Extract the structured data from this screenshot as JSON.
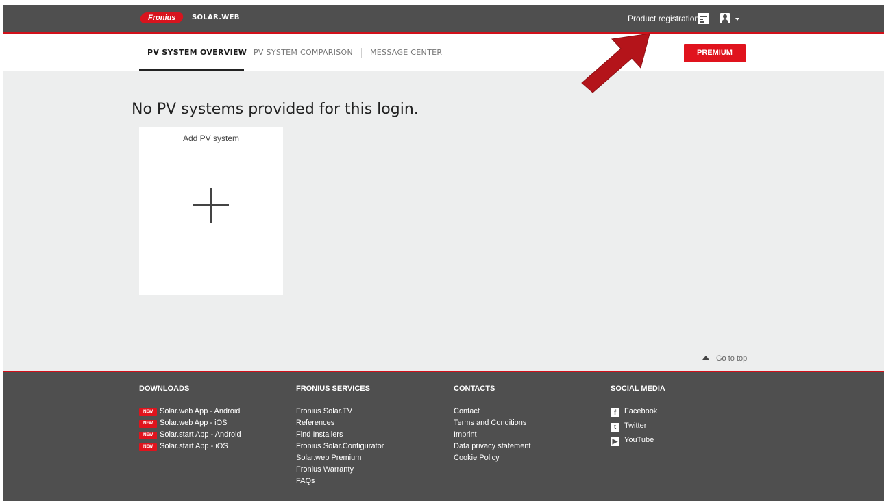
{
  "header": {
    "logo_text": "Fronius",
    "brand": "SOLAR.WEB",
    "product_registration": "Product registration"
  },
  "nav": {
    "tabs": [
      {
        "label": "PV SYSTEM OVERVIEW",
        "active": true
      },
      {
        "label": "PV SYSTEM COMPARISON",
        "active": false
      },
      {
        "label": "MESSAGE CENTER",
        "active": false
      }
    ],
    "premium_label": "PREMIUM"
  },
  "main": {
    "headline": "No PV systems provided for this login.",
    "add_card_label": "Add PV system",
    "go_to_top": "Go to top"
  },
  "footer": {
    "downloads": {
      "title": "DOWNLOADS",
      "new_tag": "NEW",
      "items": [
        "Solar.web App - Android",
        "Solar.web App - iOS",
        "Solar.start App - Android",
        "Solar.start App - iOS"
      ]
    },
    "services": {
      "title": "FRONIUS SERVICES",
      "items": [
        "Fronius Solar.TV",
        "References",
        "Find Installers",
        "Fronius Solar.Configurator",
        "Solar.web Premium",
        "Fronius Warranty",
        "FAQs"
      ]
    },
    "contacts": {
      "title": "CONTACTS",
      "items": [
        "Contact",
        "Terms and Conditions",
        "Imprint",
        "Data privacy statement",
        "Cookie Policy"
      ]
    },
    "social": {
      "title": "SOCIAL MEDIA",
      "items": [
        {
          "label": "Facebook",
          "icon": "facebook-icon"
        },
        {
          "label": "Twitter",
          "icon": "twitter-icon"
        },
        {
          "label": "YouTube",
          "icon": "youtube-icon"
        }
      ]
    }
  },
  "colors": {
    "brand_red": "#e0131d",
    "bar_dark": "#4f4f4f",
    "background": "#edeeee"
  }
}
